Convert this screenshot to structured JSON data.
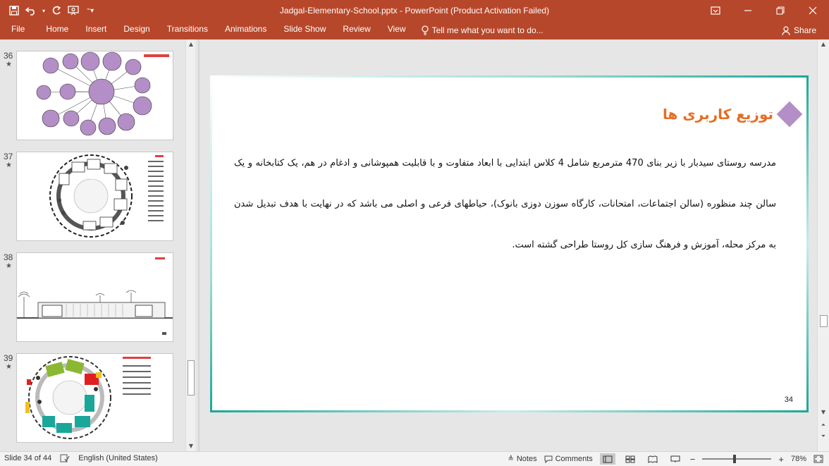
{
  "window": {
    "title": "Jadgal-Elementary-School.pptx - PowerPoint (Product Activation Failed)"
  },
  "qat": {
    "save_icon": "save-icon",
    "undo_icon": "undo-icon",
    "redo_icon": "redo-icon",
    "present_icon": "present-icon",
    "customize_icon": "customize-icon"
  },
  "ribbon": {
    "tabs": [
      "File",
      "Home",
      "Insert",
      "Design",
      "Transitions",
      "Animations",
      "Slide Show",
      "Review",
      "View"
    ],
    "tell_me": "Tell me what you want to do...",
    "share": "Share"
  },
  "thumbnails": [
    {
      "number": "36",
      "star": "★"
    },
    {
      "number": "37",
      "star": "★"
    },
    {
      "number": "38",
      "star": "★"
    },
    {
      "number": "39",
      "star": "★"
    }
  ],
  "slide": {
    "title": "توزیع کاربری ها",
    "body": "مدرسه روستای سیدبار با زیر بنای 470 مترمربع شامل 4 کلاس ابتدایی با ابعاد متفاوت و با قابلیت همپوشانی و ادغام در هم، یک کتابخانه و یک سالن چند منظوره (سالن اجتماعات، امتحانات، کارگاه سوزن دوزی بانوک)، حیاطهای فرعی و اصلی می باشد که در نهایت با هدف تبدیل شدن به مرکز محله، آموزش و فرهنگ سازی کل روستا طراحی گشته است.",
    "number": "34"
  },
  "status": {
    "slide_info": "Slide 34 of 44",
    "language": "English (United States)",
    "notes": "Notes",
    "comments": "Comments",
    "zoom": "78%"
  },
  "colors": {
    "ribbon": "#b7472a",
    "title_accent": "#e56d24",
    "frame_teal": "#1aa79a",
    "diamond": "#b48ec7"
  }
}
